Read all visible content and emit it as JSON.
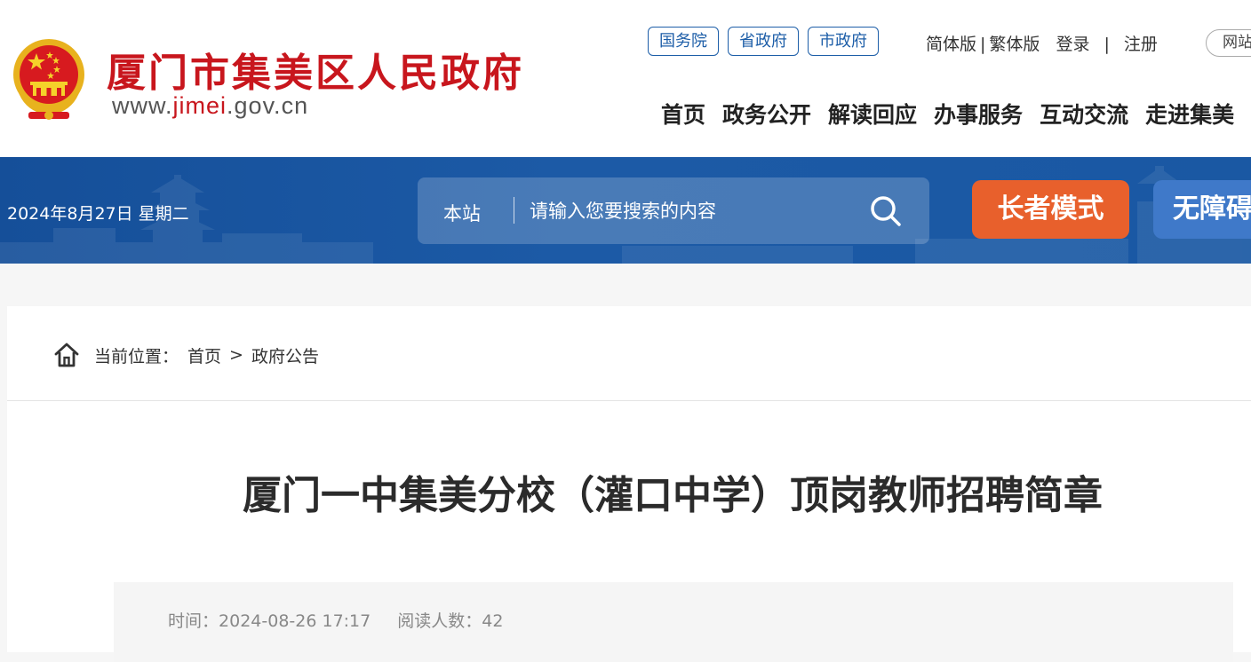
{
  "header": {
    "title": "厦门市集美区人民政府",
    "url_prefix": "www.",
    "url_highlight": "jimei",
    "url_suffix": ".gov.cn",
    "gov_links": [
      "国务院",
      "省政府",
      "市政府"
    ],
    "simplified": "简体版",
    "traditional": "繁体版",
    "separator": "|",
    "login": "登录",
    "register": "注册",
    "site_group": "网站群",
    "nav": [
      "首页",
      "政务公开",
      "解读回应",
      "办事服务",
      "互动交流",
      "走进集美"
    ]
  },
  "band": {
    "date": "2024年8月27日 星期二",
    "search_scope": "本站",
    "search_placeholder": "请输入您要搜索的内容",
    "elder_mode": "长者模式",
    "accessibility": "无障碍"
  },
  "breadcrumb": {
    "label": "当前位置：",
    "items": [
      "首页",
      "政府公告"
    ],
    "separator": ">"
  },
  "article": {
    "title": "厦门一中集美分校（灌口中学）顶岗教师招聘简章",
    "time_label": "时间：",
    "time": "2024-08-26 17:17",
    "views_label": "阅读人数：",
    "views": "42"
  },
  "colors": {
    "brand_red": "#c8161d",
    "brand_blue": "#1d5ea8",
    "band_blue": "#1a58a3",
    "elder_orange": "#e8602c",
    "access_blue": "#3f79c9"
  },
  "icons": [
    "national-emblem-icon",
    "search-icon",
    "home-icon"
  ]
}
